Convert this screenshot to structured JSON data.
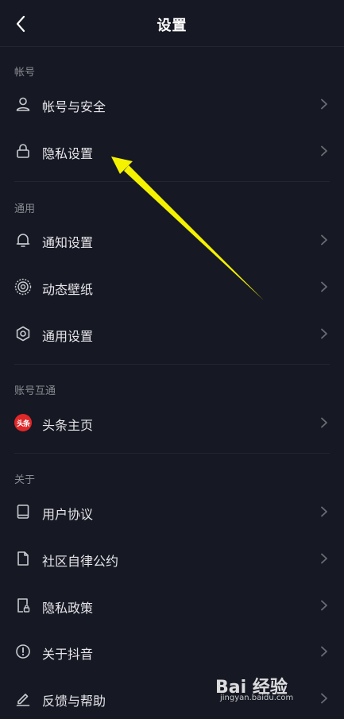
{
  "header": {
    "title": "设置",
    "back_icon": "chevron-left-icon"
  },
  "sections": [
    {
      "label": "帐号",
      "items": [
        {
          "label": "帐号与安全",
          "icon": "user-icon"
        },
        {
          "label": "隐私设置",
          "icon": "lock-icon"
        }
      ]
    },
    {
      "label": "通用",
      "items": [
        {
          "label": "通知设置",
          "icon": "bell-icon"
        },
        {
          "label": "动态壁纸",
          "icon": "wallpaper-icon"
        },
        {
          "label": "通用设置",
          "icon": "gear-icon"
        }
      ]
    },
    {
      "label": "账号互通",
      "items": [
        {
          "label": "头条主页",
          "icon": "toutiao-logo-icon",
          "badge_text": "头条",
          "badge_color": "#e02828"
        }
      ]
    },
    {
      "label": "关于",
      "items": [
        {
          "label": "用户协议",
          "icon": "book-icon"
        },
        {
          "label": "社区自律公约",
          "icon": "document-icon"
        },
        {
          "label": "隐私政策",
          "icon": "privacy-doc-icon"
        },
        {
          "label": "关于抖音",
          "icon": "info-icon"
        },
        {
          "label": "反馈与帮助",
          "icon": "edit-icon"
        }
      ]
    }
  ],
  "colors": {
    "background": "#161823",
    "text": "#e6e6ea",
    "section_label": "#8a8b92",
    "annotation_arrow": "#f4f200"
  },
  "watermark": {
    "brand": "Bai 经验",
    "url": "jingyan.baidu.com"
  }
}
